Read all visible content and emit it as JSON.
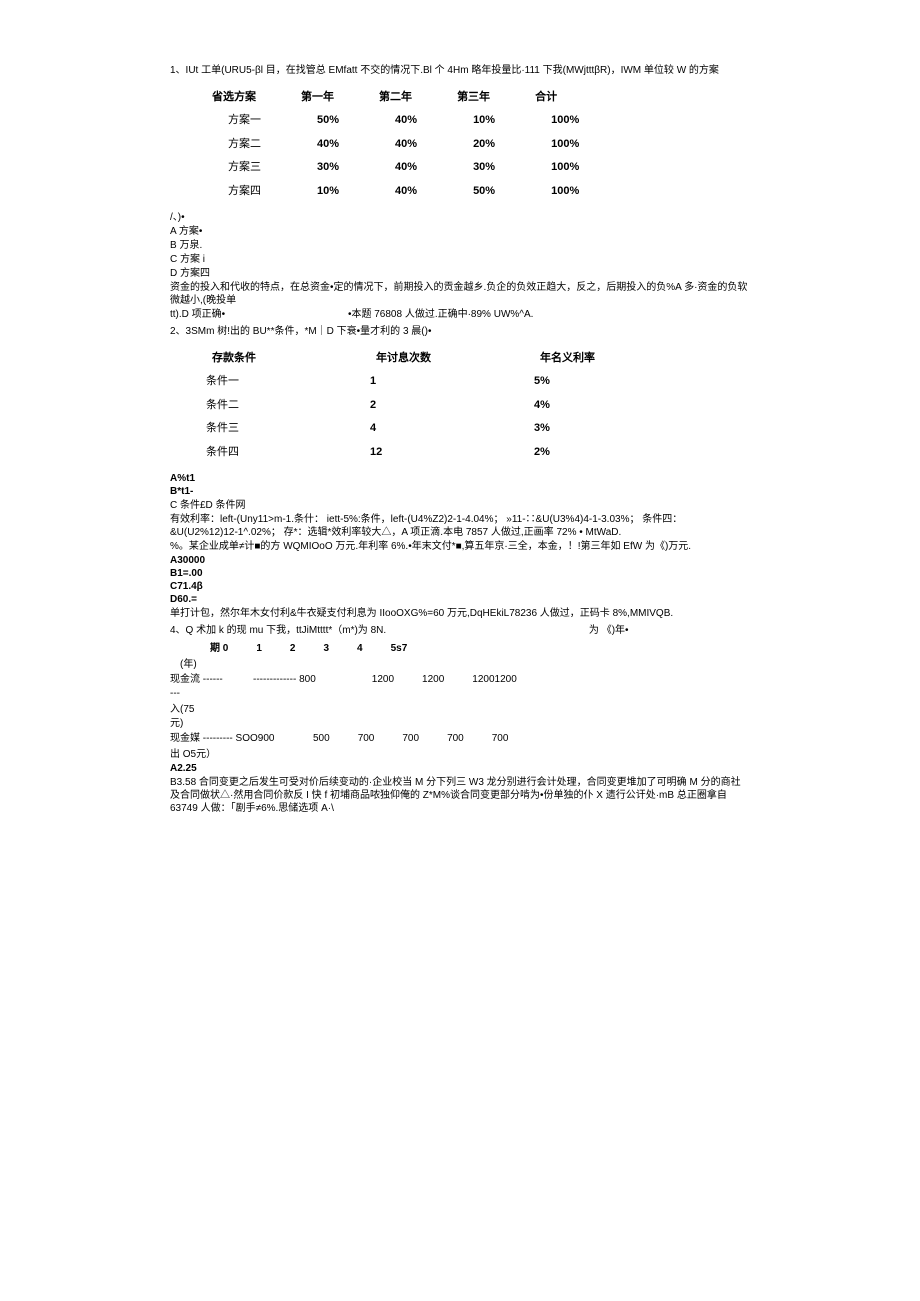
{
  "q1": {
    "text": "1、IUt 工单(URU5-βl 目，在找管总 EMfatt 不交的情况下.Bl 个 4Hm 略年投量比·111 下我(MWjtttβR)，IWM 单位较 W 的方案",
    "table": {
      "headers": [
        "省选方案",
        "第一年",
        "第二年",
        "第三年",
        "合计"
      ],
      "rows": [
        [
          "方案一",
          "50%",
          "40%",
          "10%",
          "100%"
        ],
        [
          "方案二",
          "40%",
          "40%",
          "20%",
          "100%"
        ],
        [
          "方案三",
          "30%",
          "40%",
          "30%",
          "100%"
        ],
        [
          "方案四",
          "10%",
          "40%",
          "50%",
          "100%"
        ]
      ]
    },
    "options": [
      "/、)•",
      "A 方案•",
      "B 万泉.",
      "C 方案 i",
      "D 方案四"
    ],
    "note1": "资金的投入和代收的特点，在总资金•定的情况下，前期投入的贡金越乡.负企的负效正趋大，反之，后期投入的负%A 多·资金的负软微越小,(晚投单",
    "note2_left": "tt).D 项正确•",
    "note2_right": "•本题 76808 人做过.正确中·89% UW%^A."
  },
  "q2": {
    "text": "2、3SMm 树!出的 BU**条件，*M｜D 下衰•量才利的 3 晨()•",
    "table": {
      "headers": [
        "存款条件",
        "年讨息次数",
        "年名义利率"
      ],
      "rows": [
        [
          "条件一",
          "1",
          "5%"
        ],
        [
          "条件二",
          "2",
          "4%"
        ],
        [
          "条件三",
          "4",
          "3%"
        ],
        [
          "条件四",
          "12",
          "2%"
        ]
      ]
    },
    "opts_l1": "A%t1",
    "opts_l2": "B*t1-",
    "opts_l3": "C 条件£D 条件网",
    "note1": "有效利率：left-(Uny11>m-1.条什： iett-5%:条件，left-(U4%Z2)2-1-4.04%； »11-∷&U(U3%4)4-1-3.03%； 条件四：&U(U2%12)12-1^.02%； 存*：选辑*效利率较大△，A 项正滴.本电 7857 人做过,正画率 72% •  MtWaD.",
    "note2": "%。某企业成单≠计■的方 WQMIOoO 万元.年利率 6%.•年末文付*■,算五年京·三全，本金，！!第三年如 EfW 为《)万元.",
    "o1": "A30000",
    "o2": "B1=.00",
    "o3": "C71.4β",
    "o4": "D60.=",
    "note3": "单打计包，然尔年木女付利&牛衣疑支付利息为 IIooOXG%=60 万元,DqHEkiL78236 人做过，正码卡 8%,MMIVQB."
  },
  "q4": {
    "text_l": "4、Q 术加 k 的现 mu 下我，ttJiMtttt*（m*)为 8N.",
    "text_r": "为 《)年•",
    "headers": [
      "期 0",
      "1",
      "2",
      "3",
      "4",
      "5s7"
    ],
    "yr": "(年)",
    "r1_label": "现金流 ---------",
    "r1_vals": [
      "------------- 800",
      "",
      "1200",
      "1200",
      "12001200"
    ],
    "r2": "入(75",
    "r3": "元)",
    "r4_label": "现金媒 --------- SOO900",
    "r4_vals": [
      "500",
      "700",
      "700",
      "700",
      "700"
    ],
    "r5": "出 O5元）",
    "o1": "A2.25",
    "note": "B3.58 合同变更之后发生可受对价后续变动的·企业校当 M 分下列三 W3 龙分别进行会计处理，合同变更堆加了可明确 M 分的商社及合同做状△·然用合同价款反 I 快 f 初埔商品哝独仰俺的 Z*M%谈合同变更部分啃为•份单独的仆 X 遗行公讦处·mB 总正圈拿自 63749 人做：「剧手≠6%.思储选项 A·\\"
  }
}
